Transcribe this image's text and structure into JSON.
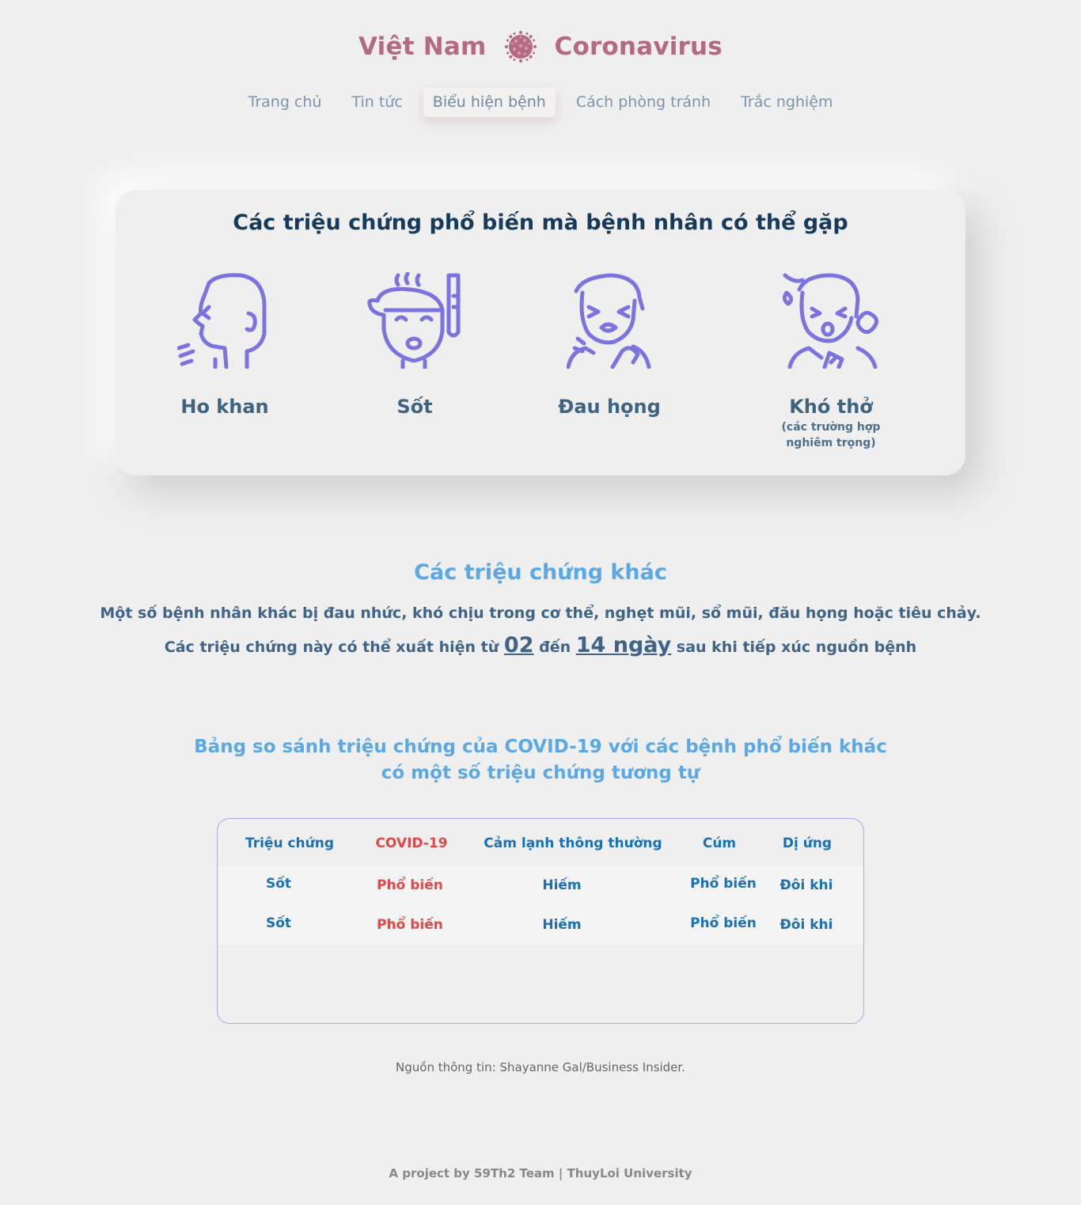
{
  "header": {
    "brand_left": "Việt Nam",
    "brand_right": "Coronavirus",
    "logo_icon": "virus-icon",
    "accent_color": "#b56a83"
  },
  "nav": {
    "items": [
      {
        "label": "Trang chủ"
      },
      {
        "label": "Tin tức"
      },
      {
        "label": "Biểu hiện bệnh",
        "active": true
      },
      {
        "label": "Cách phòng tránh"
      },
      {
        "label": "Trắc nghiệm"
      }
    ]
  },
  "common": {
    "title": "Các triệu chứng phổ biến mà bệnh nhân có thể gặp",
    "symptoms": [
      {
        "label": "Ho khan",
        "icon": "dry-cough-icon"
      },
      {
        "label": "Sốt",
        "icon": "fever-icon"
      },
      {
        "label": "Đau họng",
        "icon": "sore-throat-icon"
      },
      {
        "label": "Khó thở",
        "note": "(các trường hợp nghiêm trọng)",
        "icon": "shortness-of-breath-icon"
      }
    ],
    "icon_color": "#7b73e0"
  },
  "other": {
    "title": "Các triệu chứng khác",
    "line1": "Một số bệnh nhân khác bị đau nhức, khó chịu trong cơ thể, nghẹt mũi, sổ mũi, đău họng hoặc tiêu chảy.",
    "line2_a": "Các triệu chứng này có thể xuất hiện từ",
    "line2_num1": "02",
    "line2_b": "đến",
    "line2_num2": "14 ngày",
    "line2_c": "sau khi tiếp xúc nguồn bệnh"
  },
  "comparison": {
    "title_line1": "Bảng so sánh triệu chứng của COVID-19 với các bệnh phổ biến khác",
    "title_line2": "có một số triệu chứng tương tự",
    "headers": [
      "Triệu chứng",
      "COVID-19",
      "Cảm lạnh thông thường",
      "Cúm",
      "Dị ứng"
    ],
    "rows": [
      [
        "Sốt",
        "Phổ biến",
        "Hiếm",
        "Phổ biến",
        "Đôi khi"
      ],
      [
        "Sốt",
        "Phổ biến",
        "Hiếm",
        "Phổ biến",
        "Đôi khi"
      ]
    ],
    "covid_color": "#e04848",
    "text_color": "#1a70b8"
  },
  "source": "Nguồn thông tin: Shayanne Gal/Business Insider.",
  "footer": "A project by 59Th2 Team  |  ThuyLoi University"
}
